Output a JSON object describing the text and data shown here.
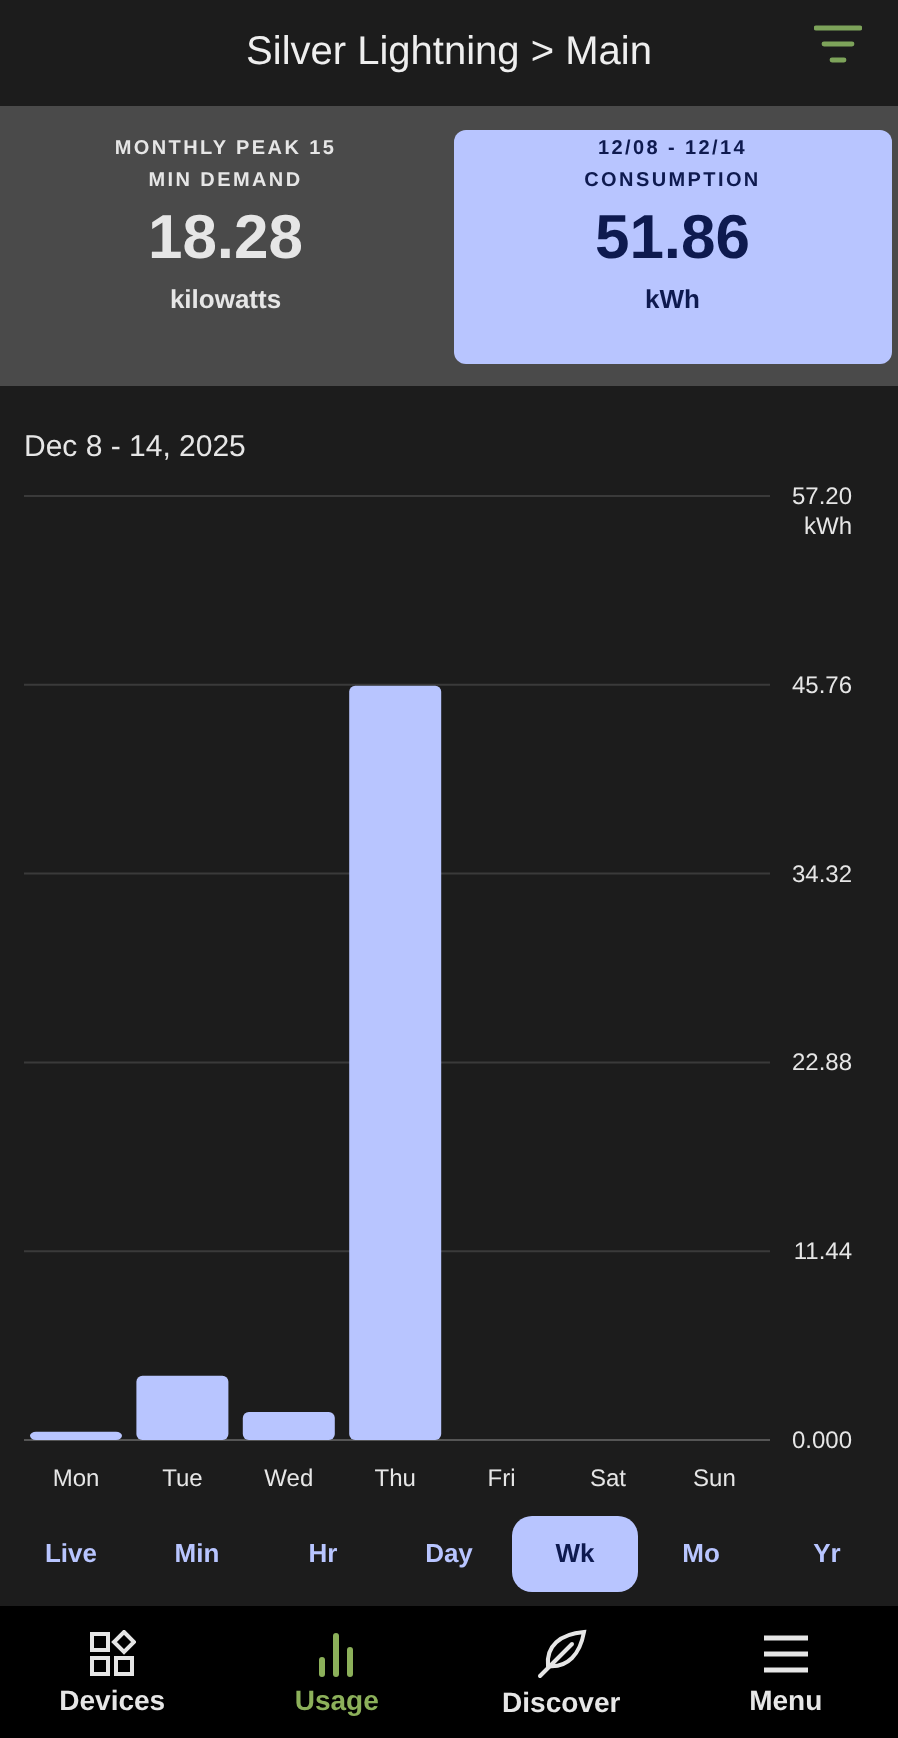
{
  "header": {
    "title": "Silver Lightning > Main"
  },
  "cards": [
    {
      "label_line_1": "MONTHLY PEAK 15",
      "label_line_2": "MIN DEMAND",
      "value": "18.28",
      "unit": "kilowatts",
      "selected": false
    },
    {
      "label_line_1": "12/08 - 12/14",
      "label_line_2": "CONSUMPTION",
      "value": "51.86",
      "unit": "kWh",
      "selected": true
    }
  ],
  "date_range": "Dec 8 - 14, 2025",
  "chart_data": {
    "type": "bar",
    "grid": true,
    "ylabel": "kWh",
    "categories": [
      "Mon",
      "Tue",
      "Wed",
      "Thu",
      "Fri",
      "Sat",
      "Sun"
    ],
    "values": [
      0.5,
      3.9,
      1.7,
      45.7,
      null,
      null,
      null
    ],
    "ylim": [
      0,
      57.2
    ],
    "yticks": [
      {
        "value": 0,
        "label": "0.000"
      },
      {
        "value": 11.44,
        "label": "11.44"
      },
      {
        "value": 22.88,
        "label": "22.88"
      },
      {
        "value": 34.32,
        "label": "34.32"
      },
      {
        "value": 45.76,
        "label": "45.76"
      },
      {
        "value": 57.2,
        "label": "57.20"
      }
    ]
  },
  "periods": [
    {
      "label": "Live",
      "selected": false
    },
    {
      "label": "Min",
      "selected": false
    },
    {
      "label": "Hr",
      "selected": false
    },
    {
      "label": "Day",
      "selected": false
    },
    {
      "label": "Wk",
      "selected": true
    },
    {
      "label": "Mo",
      "selected": false
    },
    {
      "label": "Yr",
      "selected": false
    }
  ],
  "nav": [
    {
      "kind": "devices",
      "label": "Devices",
      "selected": false
    },
    {
      "kind": "usage",
      "label": "Usage",
      "selected": true
    },
    {
      "kind": "discover",
      "label": "Discover",
      "selected": false
    },
    {
      "kind": "menu",
      "label": "Menu",
      "selected": false
    }
  ]
}
